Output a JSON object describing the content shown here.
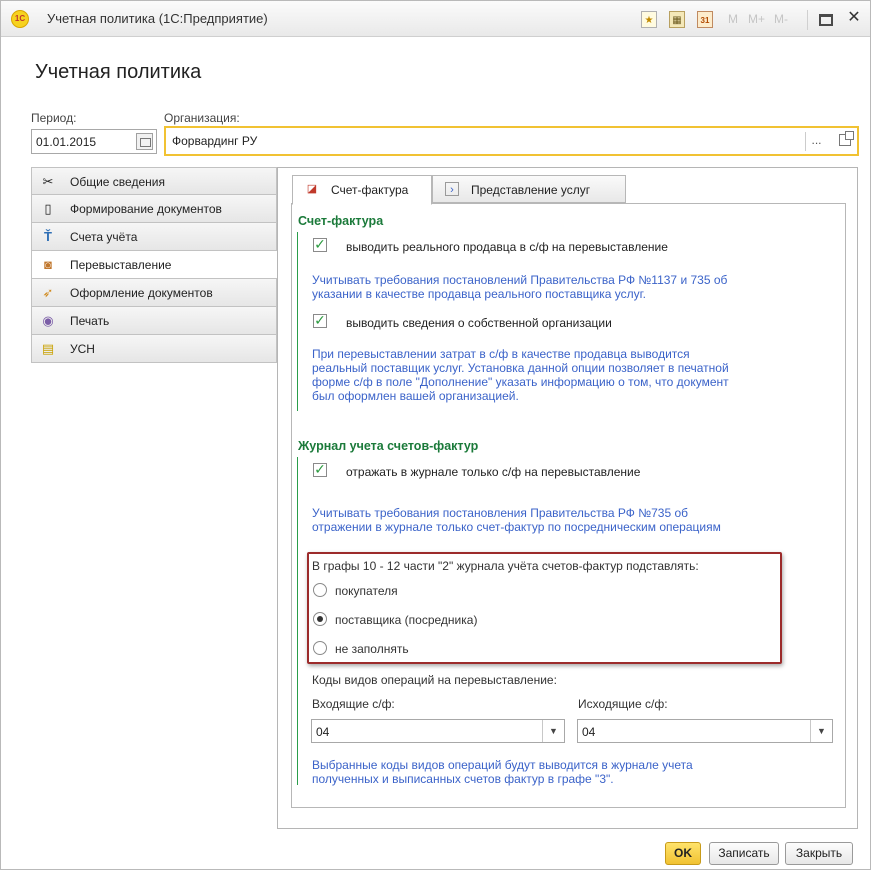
{
  "window": {
    "title": "Учетная политика  (1С:Предприятие)",
    "logo": "1С",
    "toolbar": {
      "m": "M",
      "m_plus": "M+",
      "m_minus": "M-",
      "cal_day": "31"
    }
  },
  "form": {
    "title": "Учетная политика",
    "period_label": "Период:",
    "period_value": "01.01.2015",
    "org_label": "Организация:",
    "org_value": "Форвардинг РУ",
    "org_select": "..."
  },
  "nav": {
    "items": [
      {
        "label": "Общие сведения",
        "icon": "tools-icon"
      },
      {
        "label": "Формирование документов",
        "icon": "document-icon"
      },
      {
        "label": "Счета учёта",
        "icon": "accounts-icon"
      },
      {
        "label": "Перевыставление",
        "icon": "reissue-icon",
        "active": true
      },
      {
        "label": "Оформление документов",
        "icon": "design-icon"
      },
      {
        "label": "Печать",
        "icon": "print-icon"
      },
      {
        "label": "УСН",
        "icon": "usn-icon"
      }
    ]
  },
  "tabs": [
    {
      "label": "Счет-фактура",
      "active": true
    },
    {
      "label": "Представление услуг",
      "active": false
    }
  ],
  "invoice": {
    "section_title": "Счет-фактура",
    "chk1_label": "выводить реального продавца в с/ф на перевыставление",
    "info1_line1": "Учитывать требования постановлений Правительства РФ №1137 и 735 об",
    "info1_line2": "указании в качестве продавца реального поставщика услуг.",
    "chk2_label": "выводить сведения о собственной организации",
    "info2_line1": "При перевыставлении затрат в с/ф в качестве продавца выводится",
    "info2_line2": "реальный поставщик услуг. Установка данной опции позволяет в печатной",
    "info2_line3": "форме с/ф в поле \"Дополнение\" указать информацию о том, что документ",
    "info2_line4": "был оформлен вашей организацией."
  },
  "journal": {
    "section_title": "Журнал учета счетов-фактур",
    "chk3_label": "отражать в журнале только с/ф на перевыставление",
    "info3_line1": "Учитывать требования постановления Правительства РФ №735 об",
    "info3_line2": "отражении в журнале только счет-фактур по посредническим операциям",
    "radio_group_label": "В графы 10 - 12 части \"2\" журнала учёта счетов-фактур подставлять:",
    "radio_options": [
      {
        "label": "покупателя",
        "checked": false
      },
      {
        "label": "поставщика (посредника)",
        "checked": true
      },
      {
        "label": "не заполнять",
        "checked": false
      }
    ],
    "codes_label": "Коды видов операций на перевыставление:",
    "incoming_label": "Входящие с/ф:",
    "incoming_value": "04",
    "outgoing_label": "Исходящие с/ф:",
    "outgoing_value": "04",
    "info4_line1": "Выбранные коды видов операций будут выводится в журнале учета",
    "info4_line2": "полученных и выписанных счетов фактур в графе \"3\"."
  },
  "buttons": {
    "ok": "OK",
    "save": "Записать",
    "close": "Закрыть"
  },
  "colors": {
    "accent_yellow": "#f1c232",
    "section_green": "#1b7a3a",
    "info_blue": "#3b63c9",
    "highlight_red": "#9c2b2b"
  }
}
